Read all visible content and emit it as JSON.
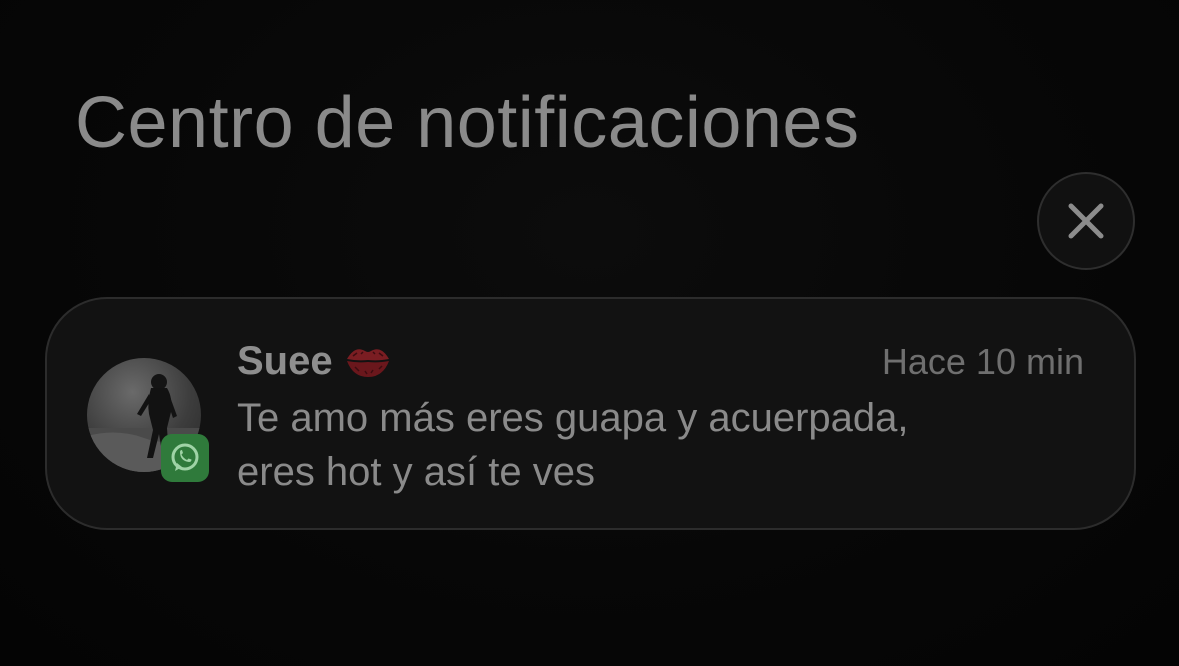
{
  "header": {
    "title": "Centro de notificaciones"
  },
  "close_button": {
    "icon": "close-icon"
  },
  "notification": {
    "app_icon": "whatsapp-icon",
    "app_color": "#2f7a3b",
    "sender": "Suee",
    "sender_emoji": "kiss-mark-icon",
    "time": "Hace 10 min",
    "message_lines": [
      "Te amo más eres guapa y acuerpada,",
      "eres hot y así te ves"
    ]
  }
}
